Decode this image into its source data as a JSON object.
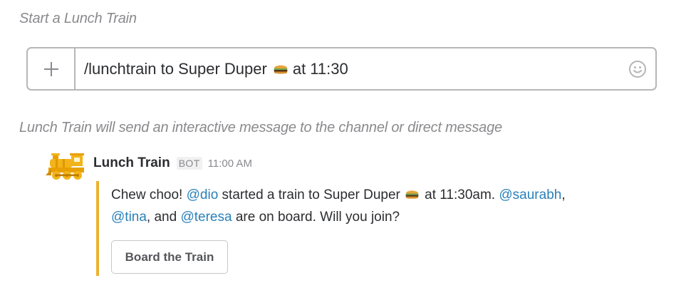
{
  "captions": {
    "start": "Start a Lunch Train",
    "result": "Lunch Train will send an interactive message to the channel or direct message"
  },
  "composer": {
    "add_icon": "plus-icon",
    "command_before_emoji": "/lunchtrain to Super Duper",
    "command_emoji": "hamburger-emoji",
    "command_after_emoji": "at 11:30",
    "emoji_icon": "smiley-icon"
  },
  "message": {
    "avatar_icon": "train-icon",
    "sender": "Lunch Train",
    "badge": "BOT",
    "time": "11:00 AM",
    "text": {
      "part1": "Chew choo! ",
      "mention_dio": "@dio",
      "part2": " started a train to Super Duper",
      "emoji": "hamburger-emoji",
      "part3": " at 11:30am. ",
      "mention_saurabh": "@saurabh",
      "part4": ",",
      "mention_tina": "@tina",
      "part5": ", and ",
      "mention_teresa": "@teresa",
      "part6": " are on board. Will you join?"
    },
    "button_label": "Board the Train"
  },
  "colors": {
    "mention": "#2a80b9",
    "attachment_bar": "#ecb22e",
    "caption": "#8a8a8e",
    "text": "#2c2d30"
  }
}
